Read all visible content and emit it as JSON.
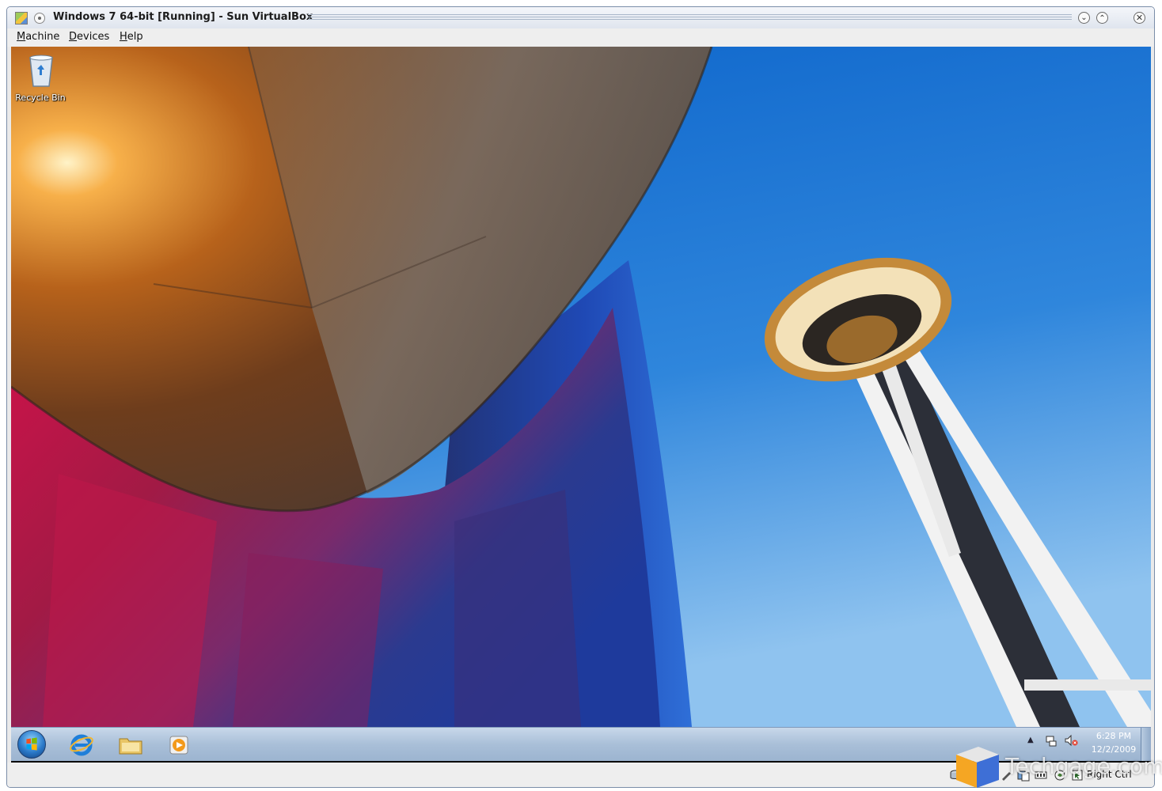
{
  "window": {
    "title": "Windows 7 64-bit [Running] - Sun VirtualBox",
    "icons": {
      "app": "virtualbox-app-icon",
      "sticky": "sticky-dot-icon",
      "minimize": "chevron-down-icon",
      "maximize": "chevron-up-icon",
      "close": "close-icon"
    }
  },
  "menubar": {
    "items": [
      {
        "label_first": "M",
        "label_rest": "achine"
      },
      {
        "label_first": "D",
        "label_rest": "evices"
      },
      {
        "label_first": "H",
        "label_rest": "elp"
      }
    ]
  },
  "desktop": {
    "recycle_bin_label": "Recycle Bin",
    "colors": {
      "sky": "#1a6fd1",
      "copper": "#c06a1e",
      "steel": "#7d6f63"
    }
  },
  "taskbar": {
    "apps": [
      "internet-explorer-icon",
      "windows-explorer-icon",
      "media-player-icon"
    ],
    "clock_time": "6:28 PM",
    "clock_date": "12/2/2009"
  },
  "statusbar": {
    "host_key_label": "Right Ctrl"
  },
  "watermark": {
    "text": "Techgage.com"
  }
}
